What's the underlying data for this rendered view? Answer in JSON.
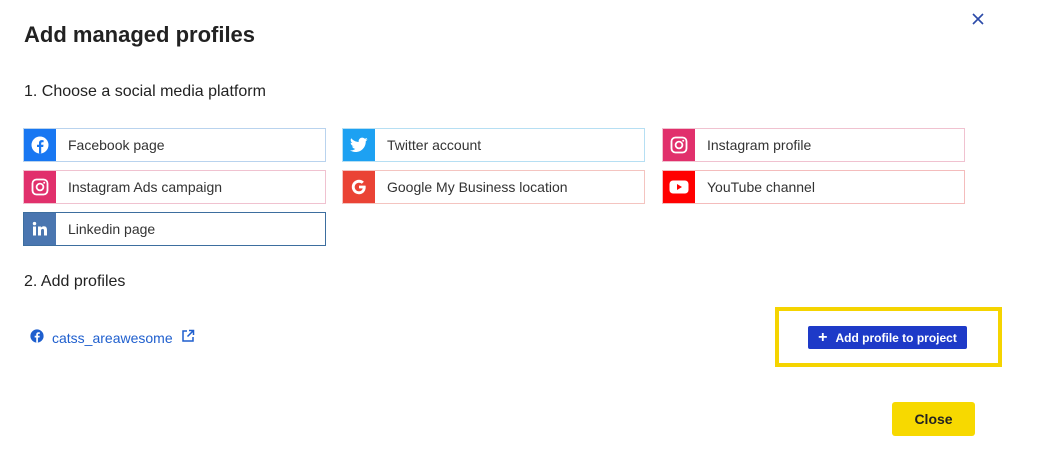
{
  "dialog": {
    "title": "Add managed profiles",
    "close_icon": "close-icon"
  },
  "step1": {
    "label": "1. Choose a social media platform",
    "platforms": [
      {
        "label": "Facebook page",
        "icon": "facebook-icon",
        "color": "#1877f2"
      },
      {
        "label": "Twitter account",
        "icon": "twitter-icon",
        "color": "#1da1f2"
      },
      {
        "label": "Instagram profile",
        "icon": "instagram-icon",
        "color": "#e1306c"
      },
      {
        "label": "Instagram Ads campaign",
        "icon": "instagram-icon",
        "color": "#e1306c"
      },
      {
        "label": "Google My Business location",
        "icon": "google-icon",
        "color": "#ea4335"
      },
      {
        "label": "YouTube channel",
        "icon": "youtube-icon",
        "color": "#ff0000"
      },
      {
        "label": "Linkedin page",
        "icon": "linkedin-icon",
        "color": "#4a76b0"
      }
    ]
  },
  "step2": {
    "label": "2. Add profiles",
    "profile": {
      "name": "catss_areawesome",
      "icon": "facebook-icon",
      "link_icon": "external-link-icon"
    },
    "add_button": {
      "plus": "+",
      "label": "Add profile to project"
    }
  },
  "footer": {
    "close_label": "Close"
  },
  "colors": {
    "primary": "#1e3ac8",
    "highlight": "#f5d400",
    "close_button": "#f7d900",
    "link": "#1f5fce"
  }
}
